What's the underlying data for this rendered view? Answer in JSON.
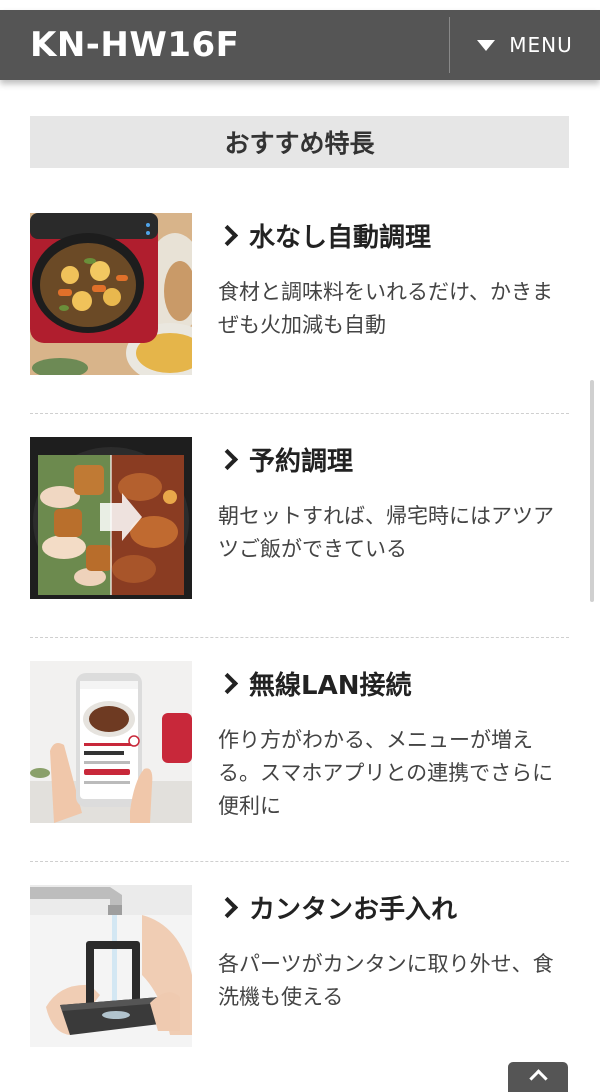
{
  "header": {
    "model": "KN-HW16F",
    "menu_label": "MENU"
  },
  "section": {
    "title": "おすすめ特長"
  },
  "features": [
    {
      "title": "水なし自動調理",
      "description": "食材と調味料をいれるだけ、かきまぜも火加減も自動",
      "image_icon": "stew-pot-image"
    },
    {
      "title": "予約調理",
      "description": "朝セットすれば、帰宅時にはアツアツご飯ができている",
      "image_icon": "before-after-pot-image"
    },
    {
      "title": "無線LAN接続",
      "description": "作り方がわかる、メニューが増える。スマホアプリとの連携でさらに便利に",
      "image_icon": "smartphone-app-image"
    },
    {
      "title": "カンタンお手入れ",
      "description": "各パーツがカンタンに取り外せ、食洗機も使える",
      "image_icon": "washing-parts-image"
    }
  ],
  "colors": {
    "header_bg": "#555555",
    "section_bg": "#e6e6e6",
    "text": "#333333"
  }
}
